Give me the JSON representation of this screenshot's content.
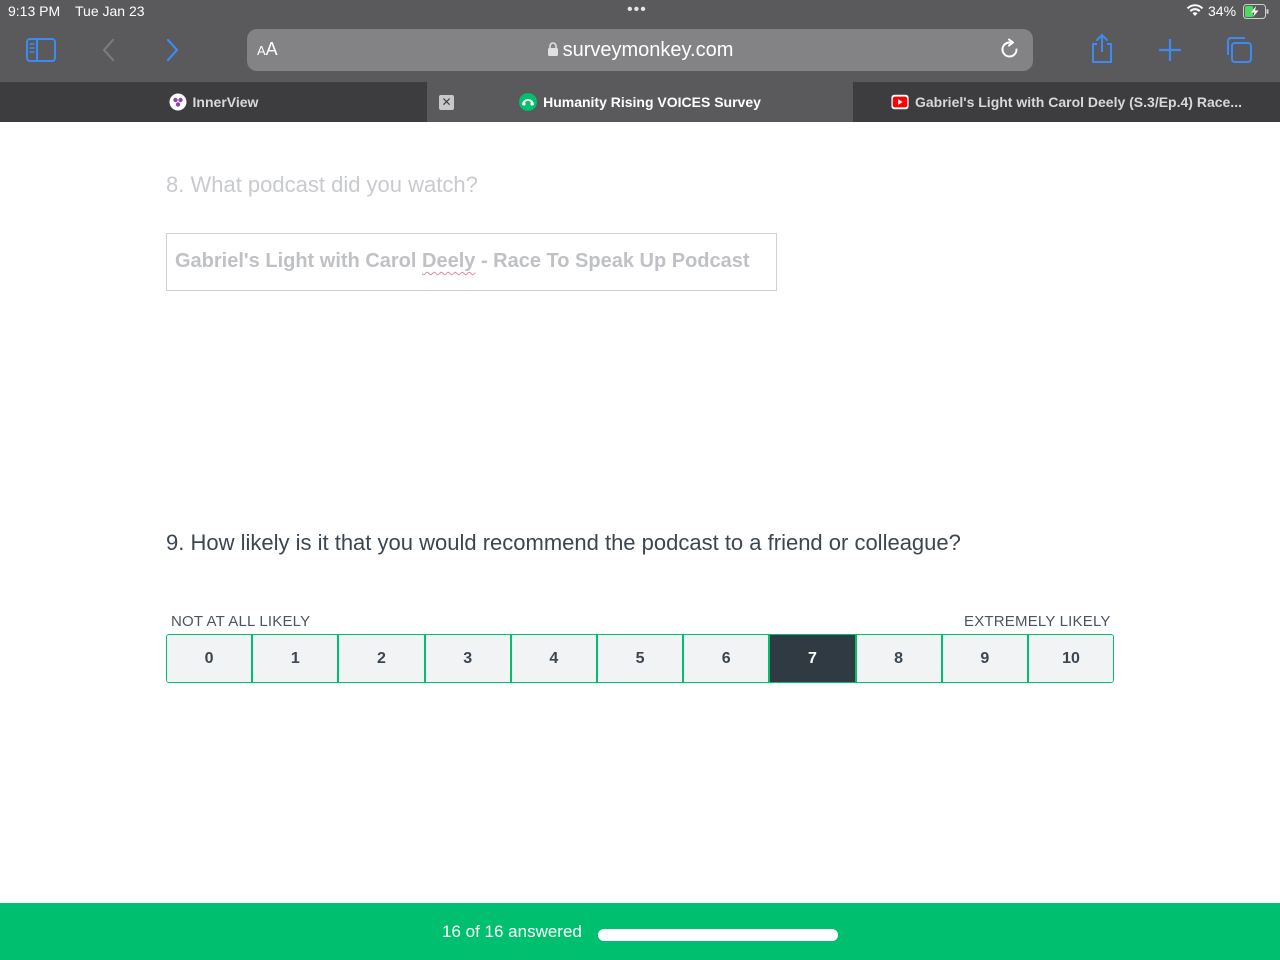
{
  "status_bar": {
    "time": "9:13 PM",
    "date": "Tue Jan 23",
    "battery": "34%"
  },
  "browser": {
    "text_size_button": "AA",
    "url": "surveymonkey.com",
    "accent": "#3d8bf2",
    "tabs": [
      {
        "label": "InnerView",
        "icon": "innerview-favicon"
      },
      {
        "label": "Humanity Rising VOICES Survey",
        "icon": "surveymonkey-favicon",
        "active": true
      },
      {
        "label": "Gabriel's Light with Carol Deely (S.3/Ep.4) Race...",
        "icon": "youtube-favicon"
      }
    ]
  },
  "survey": {
    "q8": {
      "title": "8. What podcast did you watch?",
      "answer_before": "Gabriel's Light with Carol ",
      "answer_misspelled": "Deely",
      "answer_after": " - Race To Speak Up Podcast"
    },
    "q9": {
      "title": "9. How likely is it that you would recommend the podcast to a friend or colleague?",
      "label_low": "NOT AT ALL LIKELY",
      "label_high": "EXTREMELY LIKELY",
      "options": [
        "0",
        "1",
        "2",
        "3",
        "4",
        "5",
        "6",
        "7",
        "8",
        "9",
        "10"
      ],
      "selected": "7"
    }
  },
  "footer": {
    "progress_text": "16 of 16 answered",
    "progress_fraction": 1.0,
    "color": "#00bf6f"
  }
}
